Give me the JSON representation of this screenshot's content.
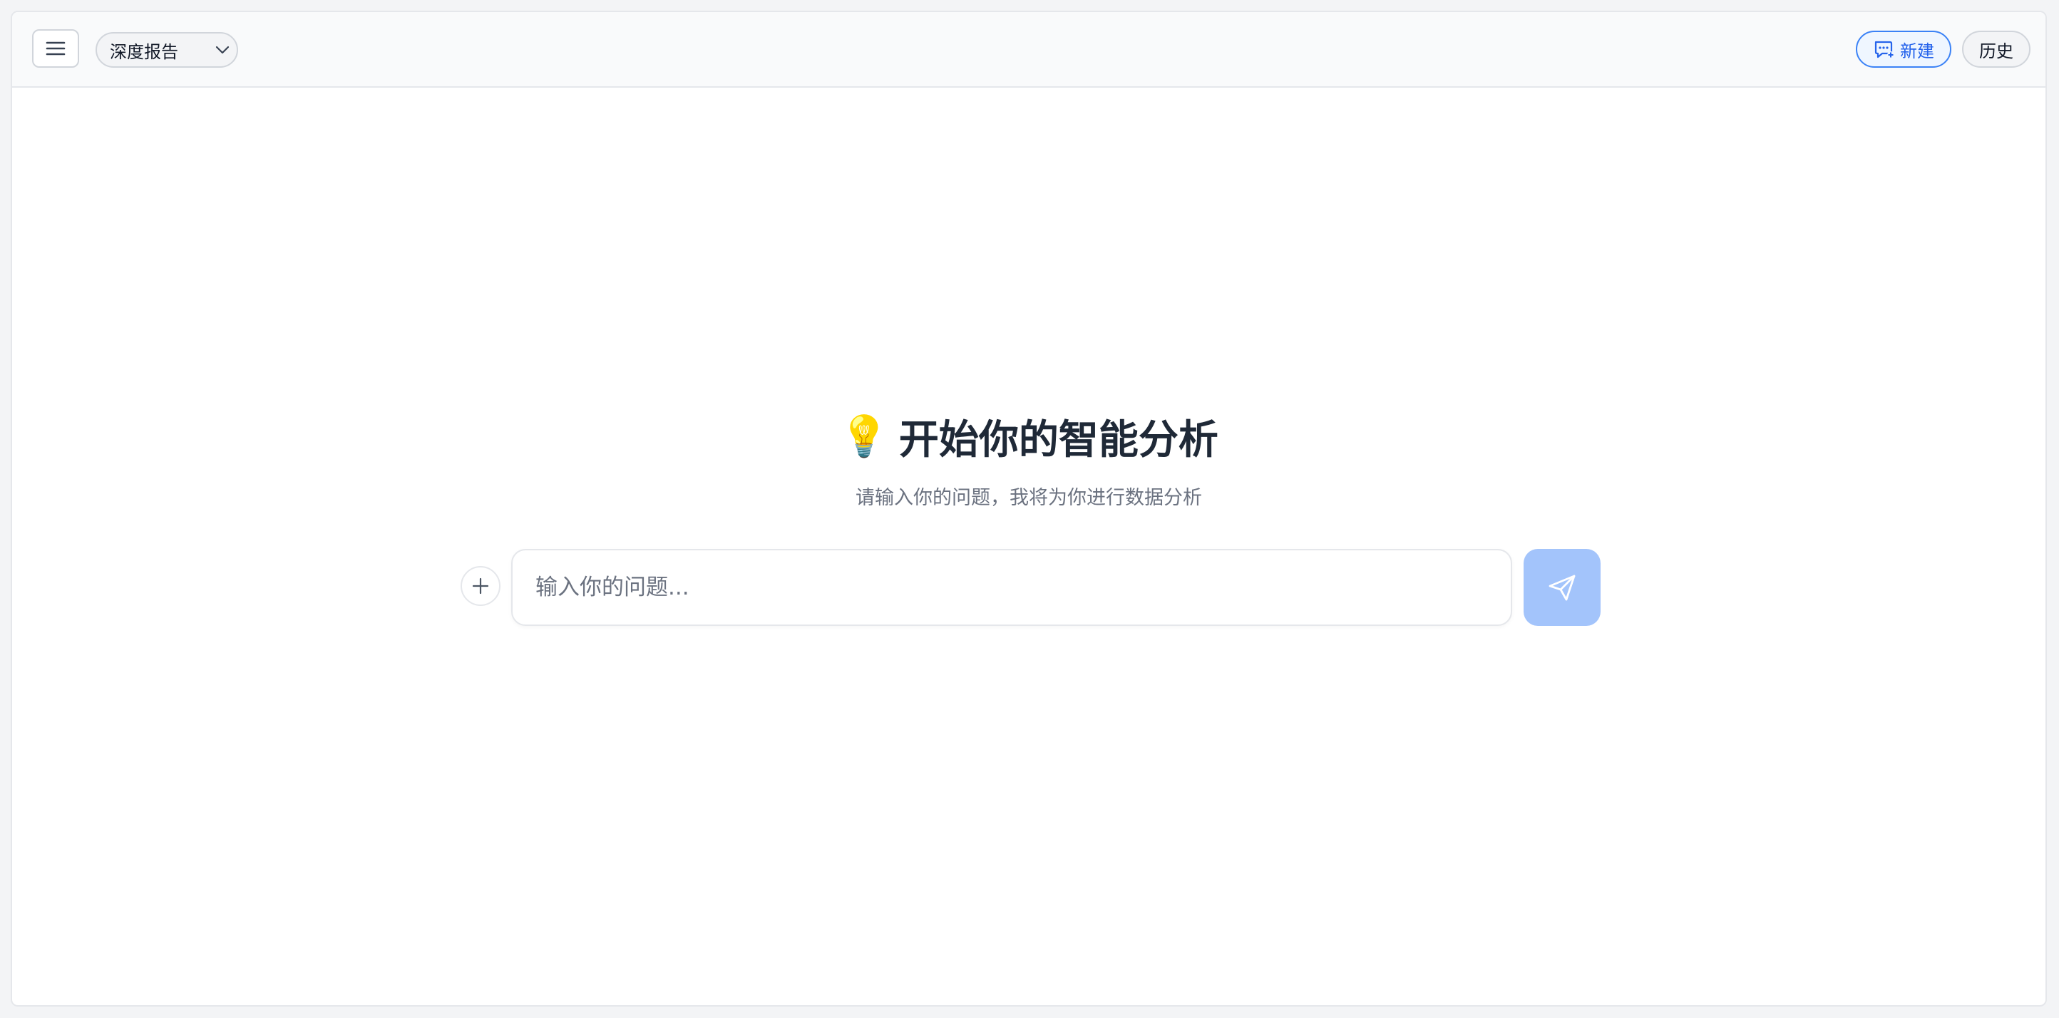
{
  "header": {
    "mode_selected": "深度报告",
    "new_label": "新建",
    "history_label": "历史"
  },
  "hero": {
    "emoji": "💡",
    "title": "开始你的智能分析",
    "subtitle": "请输入你的问题，我将为你进行数据分析"
  },
  "composer": {
    "placeholder": "输入你的问题...",
    "value": ""
  },
  "icons": {
    "menu": "menu-icon",
    "dropdown": "chevron-down-icon",
    "new_chat": "new-chat-icon",
    "attach": "plus-icon",
    "send": "send-icon"
  },
  "colors": {
    "accent": "#3b82f6",
    "send_button": "#a3c4fb",
    "title": "#1f2937",
    "subtitle": "#6b7280"
  }
}
